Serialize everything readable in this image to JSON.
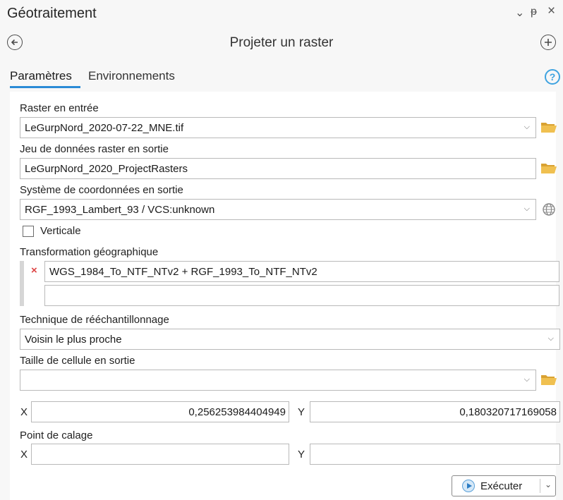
{
  "window": {
    "title": "Géotraitement",
    "controls": {
      "dropdown": "⌄",
      "pin": "ᵽ",
      "close": "×"
    }
  },
  "header": {
    "tool_title": "Projeter un raster",
    "back_icon": "back-arrow-icon",
    "add_icon": "add-icon"
  },
  "tabs": [
    {
      "label": "Paramètres",
      "active": true
    },
    {
      "label": "Environnements",
      "active": false
    }
  ],
  "help": "?",
  "params": {
    "input_raster": {
      "label": "Raster en entrée",
      "value": "LeGurpNord_2020-07-22_MNE.tif"
    },
    "output_dataset": {
      "label": "Jeu de données raster en sortie",
      "value": "LeGurpNord_2020_ProjectRasters"
    },
    "output_crs": {
      "label": "Système de coordonnées en sortie",
      "value": "RGF_1993_Lambert_93 / VCS:unknown"
    },
    "vertical": {
      "label": "Verticale",
      "checked": false
    },
    "geo_transform": {
      "label": "Transformation géographique",
      "value": "WGS_1984_To_NTF_NTv2 + RGF_1993_To_NTF_NTv2",
      "empty_value": ""
    },
    "resampling": {
      "label": "Technique de rééchantillonnage",
      "value": "Voisin le plus proche"
    },
    "cell_size": {
      "label": "Taille de cellule en sortie",
      "value": "",
      "x_label": "X",
      "x_value": "0,256253984404949",
      "y_label": "Y",
      "y_value": "0,180320717169058"
    },
    "registration_point": {
      "label": "Point de calage",
      "x_label": "X",
      "x_value": "",
      "y_label": "Y",
      "y_value": ""
    }
  },
  "run_button": {
    "label": "Exécuter",
    "chevron": "⌄"
  },
  "colors": {
    "accent": "#2b8bd6",
    "folder": "#e8b84a",
    "remove": "#d44444"
  }
}
